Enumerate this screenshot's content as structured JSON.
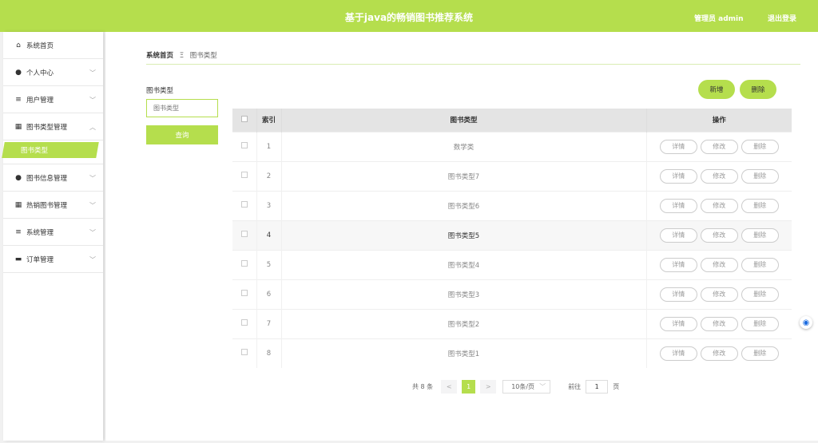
{
  "header": {
    "title": "基于java的畅销图书推荐系统",
    "user": "管理员 admin",
    "logout": "退出登录"
  },
  "sidebar": {
    "items": [
      {
        "label": "系统首页",
        "icon": "home-icon",
        "chevron": ""
      },
      {
        "label": "个人中心",
        "icon": "user-icon",
        "chevron": "﹀"
      },
      {
        "label": "用户管理",
        "icon": "list-icon",
        "chevron": "﹀"
      },
      {
        "label": "图书类型管理",
        "icon": "grid-icon",
        "chevron": "︿"
      },
      {
        "label": "图书信息管理",
        "icon": "user-icon",
        "chevron": "﹀"
      },
      {
        "label": "热销图书管理",
        "icon": "grid-icon",
        "chevron": "﹀"
      },
      {
        "label": "系统管理",
        "icon": "list-icon",
        "chevron": "﹀"
      },
      {
        "label": "订单管理",
        "icon": "chat-icon",
        "chevron": "﹀"
      }
    ],
    "active_sub": "图书类型"
  },
  "breadcrumb": {
    "home": "系统首页",
    "sep": "Ξ",
    "current": "图书类型"
  },
  "search": {
    "label": "图书类型",
    "placeholder": "图书类型",
    "button": "查询"
  },
  "actions": {
    "add": "新增",
    "delete": "删除"
  },
  "table": {
    "headers": {
      "index": "索引",
      "type": "图书类型",
      "ops": "操作"
    },
    "rows": [
      {
        "index": "1",
        "type": "数学类"
      },
      {
        "index": "2",
        "type": "图书类型7"
      },
      {
        "index": "3",
        "type": "图书类型6"
      },
      {
        "index": "4",
        "type": "图书类型5"
      },
      {
        "index": "5",
        "type": "图书类型4"
      },
      {
        "index": "6",
        "type": "图书类型3"
      },
      {
        "index": "7",
        "type": "图书类型2"
      },
      {
        "index": "8",
        "type": "图书类型1"
      }
    ],
    "row_actions": {
      "detail": "详情",
      "edit": "修改",
      "delete": "删除"
    }
  },
  "pagination": {
    "total": "共 8 条",
    "prev": "<",
    "current": "1",
    "next": ">",
    "page_size": "10条/页",
    "goto_label": "前往",
    "goto_value": "1",
    "page_suffix": "页"
  },
  "colors": {
    "accent": "#b5de4d"
  }
}
